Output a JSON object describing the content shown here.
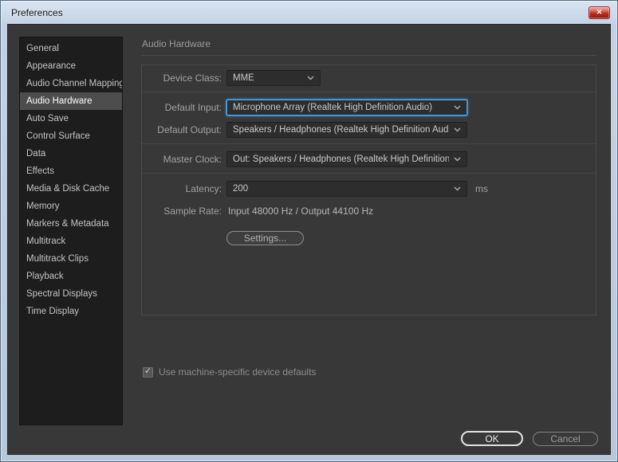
{
  "window": {
    "title": "Preferences"
  },
  "icons": {
    "close": "✕",
    "check": "✓"
  },
  "sidebar": {
    "items": [
      {
        "label": "General"
      },
      {
        "label": "Appearance"
      },
      {
        "label": "Audio Channel Mapping"
      },
      {
        "label": "Audio Hardware",
        "selected": true
      },
      {
        "label": "Auto Save"
      },
      {
        "label": "Control Surface"
      },
      {
        "label": "Data"
      },
      {
        "label": "Effects"
      },
      {
        "label": "Media & Disk Cache"
      },
      {
        "label": "Memory"
      },
      {
        "label": "Markers & Metadata"
      },
      {
        "label": "Multitrack"
      },
      {
        "label": "Multitrack Clips"
      },
      {
        "label": "Playback"
      },
      {
        "label": "Spectral Displays"
      },
      {
        "label": "Time Display"
      }
    ]
  },
  "main": {
    "heading": "Audio Hardware",
    "device_class": {
      "label": "Device Class:",
      "value": "MME"
    },
    "default_input": {
      "label": "Default Input:",
      "value": "Microphone Array (Realtek High Definition Audio)"
    },
    "default_output": {
      "label": "Default Output:",
      "value": "Speakers / Headphones (Realtek High Definition Audio)"
    },
    "master_clock": {
      "label": "Master Clock:",
      "value": "Out: Speakers / Headphones (Realtek High Definition ..."
    },
    "latency": {
      "label": "Latency:",
      "value": "200",
      "unit": "ms"
    },
    "sample_rate": {
      "label": "Sample Rate:",
      "value": "Input 48000 Hz / Output 44100 Hz"
    },
    "settings_button": "Settings...",
    "machine_defaults": {
      "label": "Use machine-specific device defaults",
      "checked": true
    }
  },
  "footer": {
    "ok": "OK",
    "cancel": "Cancel"
  },
  "colors": {
    "focus_accent": "#4aa0e0",
    "dialog_bg": "#383838",
    "sidebar_bg": "#1d1d1d",
    "selected_item_bg": "#4d4d4d",
    "close_button_red": "#b8281d"
  }
}
